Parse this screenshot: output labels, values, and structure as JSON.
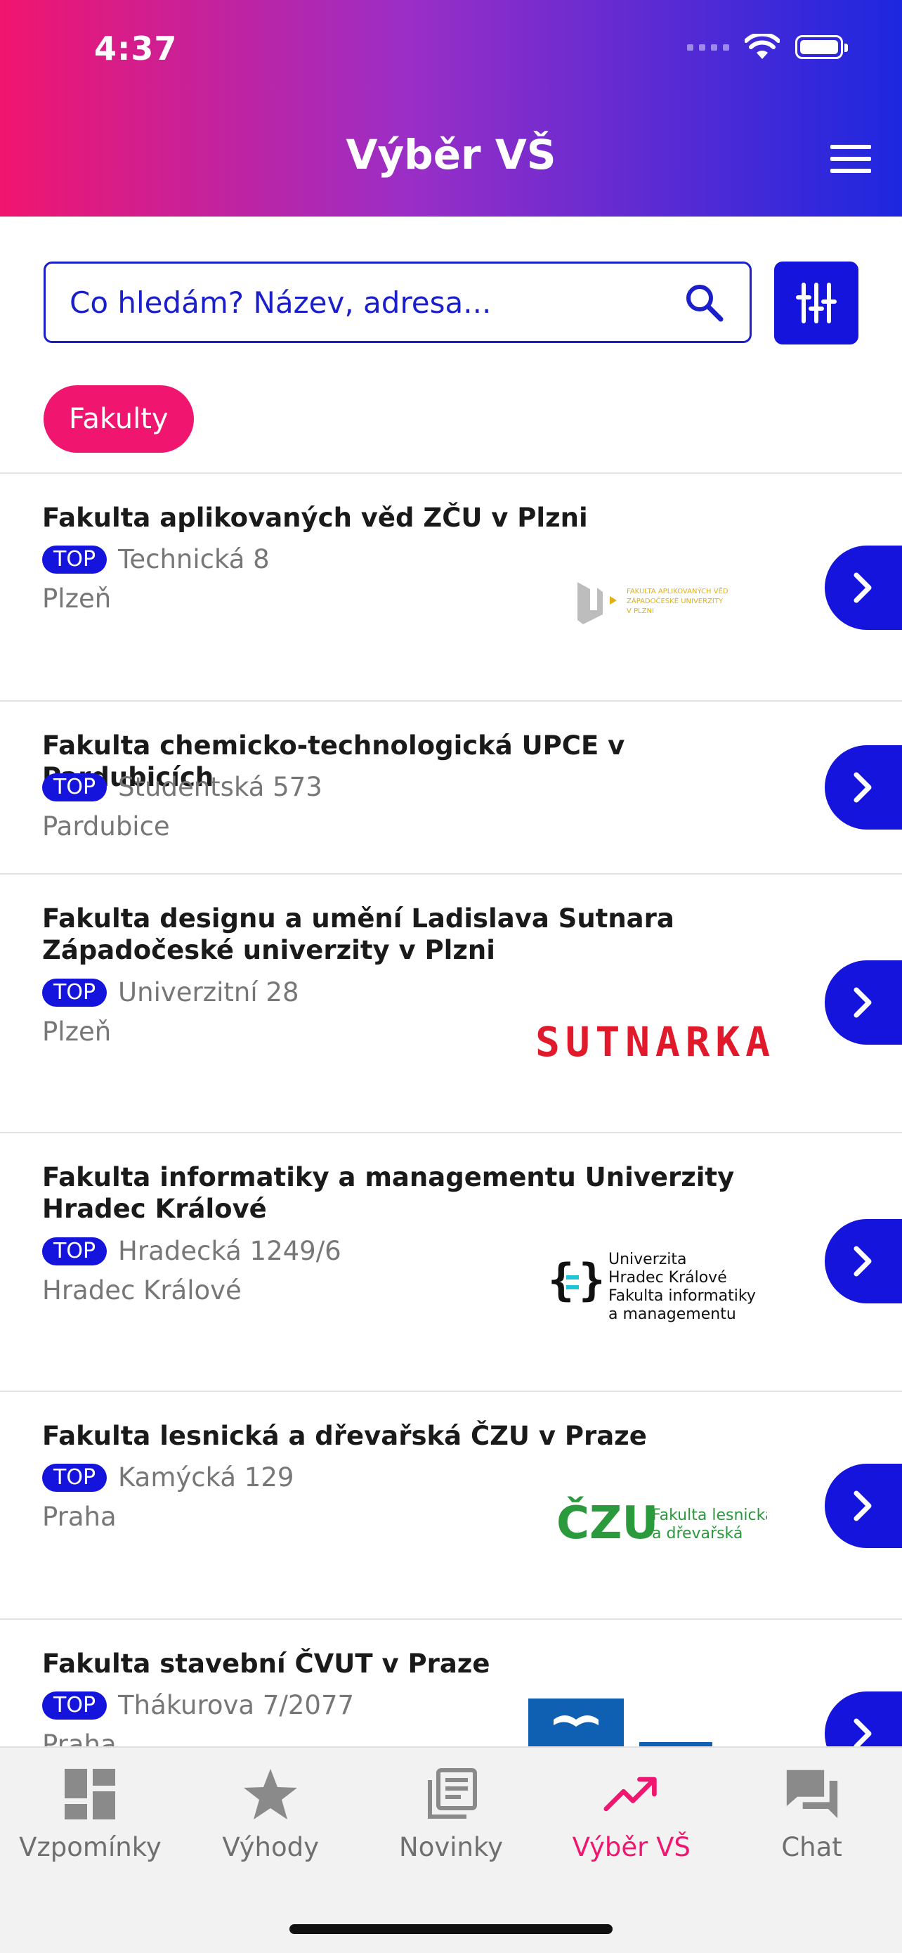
{
  "status_bar": {
    "time": "4:37"
  },
  "header": {
    "title": "Výběr VŠ"
  },
  "search": {
    "placeholder": "Co hledám? Název, adresa..."
  },
  "chip": {
    "label": "Fakulty"
  },
  "badge_text": "TOP",
  "faculties": [
    {
      "name": "Fakulta aplikovaných věd ZČU v Plzni",
      "address": "Technická 8",
      "city": "Plzeň",
      "logo_text": [
        "FAKULTA APLIKOVANÝCH VĚD",
        "ZÁPADOČESKÉ UNIVERZITY",
        "V PLZNI"
      ]
    },
    {
      "name": "Fakulta chemicko-technologická UPCE v Pardubicích",
      "address": "Studentská 573",
      "city": "Pardubice"
    },
    {
      "name": "Fakulta designu a umění Ladislava Sutnara Západočeské univerzity v Plzni",
      "address": "Univerzitní 28",
      "city": "Plzeň",
      "logo_text": [
        "SUTNARKA"
      ]
    },
    {
      "name": "Fakulta informatiky a managementu Univerzity Hradec Králové",
      "address": "Hradecká 1249/6",
      "city": "Hradec Králové",
      "logo_text": [
        "Univerzita",
        "Hradec Králové",
        "Fakulta informatiky",
        "a managementu"
      ]
    },
    {
      "name": "Fakulta lesnická a dřevařská ČZU v Praze",
      "address": "Kamýcká 129",
      "city": "Praha",
      "logo_text": [
        "ČZU",
        "Fakulta lesnická",
        "a dřevařská"
      ]
    },
    {
      "name": "Fakulta stavební ČVUT v Praze",
      "address": "Thákurova 7/2077",
      "city": "Praha"
    }
  ],
  "tabs": [
    {
      "label": "Vzpomínky",
      "icon": "dashboard-icon"
    },
    {
      "label": "Výhody",
      "icon": "star-icon"
    },
    {
      "label": "Novinky",
      "icon": "news-icon"
    },
    {
      "label": "Výběr VŠ",
      "icon": "trending-up-icon",
      "active": true
    },
    {
      "label": "Chat",
      "icon": "chat-icon"
    }
  ],
  "colors": {
    "primary": "#1414dc",
    "accent": "#f0156e",
    "gradient_start": "#f0156e",
    "gradient_end": "#1d27df"
  }
}
